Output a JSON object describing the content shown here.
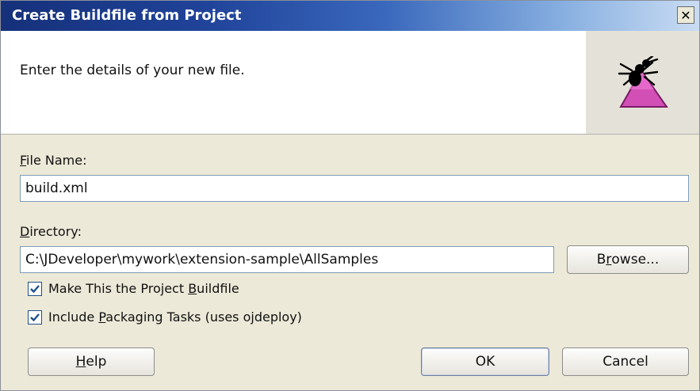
{
  "window": {
    "title": "Create Buildfile from Project",
    "close_glyph": "✕"
  },
  "header": {
    "text": "Enter the details of your new file.",
    "icon": "ant-icon"
  },
  "form": {
    "file_name": {
      "label_key": "F",
      "label_rest": "ile Name:",
      "value": "build.xml"
    },
    "directory": {
      "label_key": "D",
      "label_rest": "irectory:",
      "value": "C:\\JDeveloper\\mywork\\extension-sample\\AllSamples"
    },
    "browse": {
      "label_pre": "B",
      "label_key": "r",
      "label_post": "owse..."
    },
    "make_buildfile": {
      "checked": true,
      "label_pre": "Make This the Project ",
      "label_key": "B",
      "label_post": "uildfile"
    },
    "include_packaging": {
      "checked": true,
      "label_pre": "Include ",
      "label_key": "P",
      "label_post": "ackaging Tasks (uses ojdeploy)"
    }
  },
  "buttons": {
    "help": {
      "label_key": "H",
      "label_rest": "elp"
    },
    "ok": {
      "label": "OK"
    },
    "cancel": {
      "label": "Cancel"
    }
  },
  "colors": {
    "title_start": "#16307a",
    "title_end": "#c9dcf3",
    "dialog_bg": "#ece9d8",
    "checkbox_check": "#1f4f8a"
  }
}
